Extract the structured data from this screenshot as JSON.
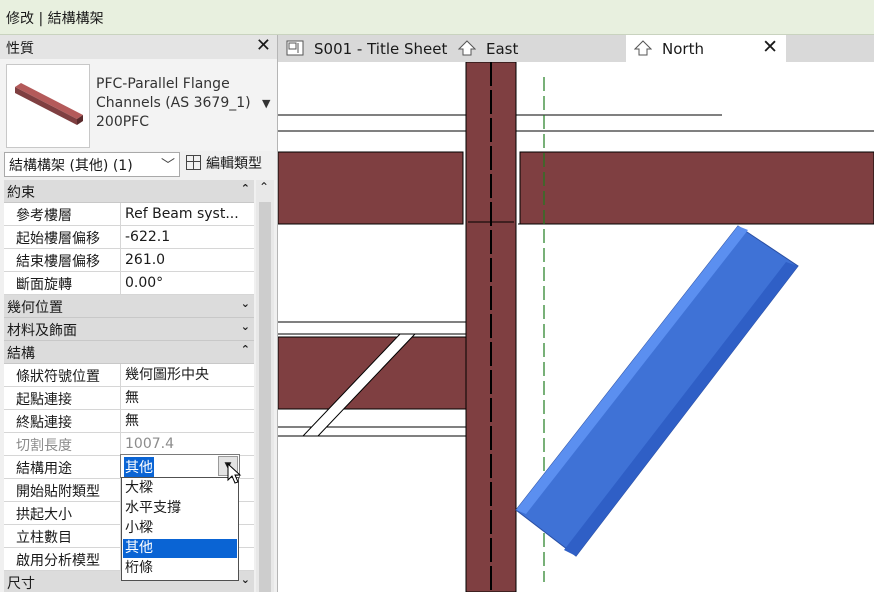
{
  "ribbon": {
    "context_title": "修改 | 結構構架"
  },
  "properties": {
    "title": "性質",
    "close_icon": "close-icon",
    "type_name": "PFC-Parallel Flange Channels (AS 3679_1) 200PFC",
    "instance_selector": "結構構架 (其他) (1)",
    "edit_type_label": "編輯類型",
    "groups": [
      {
        "label": "約束",
        "state": "expanded",
        "rows": [
          {
            "label": "參考樓層",
            "value": "Ref Beam syst..."
          },
          {
            "label": "起始樓層偏移",
            "value": "-622.1"
          },
          {
            "label": "結束樓層偏移",
            "value": "261.0"
          },
          {
            "label": "斷面旋轉",
            "value": "0.00°"
          }
        ]
      },
      {
        "label": "幾何位置",
        "state": "collapsed",
        "rows": []
      },
      {
        "label": "材料及飾面",
        "state": "collapsed",
        "rows": []
      },
      {
        "label": "結構",
        "state": "expanded",
        "rows": [
          {
            "label": "條狀符號位置",
            "value": "幾何圖形中央"
          },
          {
            "label": "起點連接",
            "value": "無"
          },
          {
            "label": "終點連接",
            "value": "無"
          },
          {
            "label": "切割長度",
            "value": "1007.4",
            "disabled": true
          },
          {
            "label": "結構用途",
            "value": "其他"
          },
          {
            "label": "開始貼附類型",
            "value": ""
          },
          {
            "label": "拱起大小",
            "value": ""
          },
          {
            "label": "立柱數目",
            "value": ""
          },
          {
            "label": "啟用分析模型",
            "value": ""
          }
        ]
      },
      {
        "label": "尺寸",
        "state": "collapsed",
        "rows": []
      }
    ],
    "structural_usage_dropdown": {
      "selected": "其他",
      "options": [
        "大樑",
        "水平支撐",
        "小樑",
        "其他",
        "桁條"
      ]
    }
  },
  "tabs": [
    {
      "label": "S001 - Title Sheet",
      "icon": "sheet-icon",
      "active": false
    },
    {
      "label": "East",
      "icon": "elevation-view-icon",
      "active": false
    },
    {
      "label": "North",
      "icon": "elevation-view-icon",
      "active": true,
      "close_icon": "close-icon"
    }
  ],
  "colors": {
    "ribbon_bg": "#e8f0df",
    "structural_member": "#7f3f41",
    "selected_member": "#3f72d6",
    "grid_line": "#1e7d1e",
    "selection_highlight": "#0a64d4"
  }
}
